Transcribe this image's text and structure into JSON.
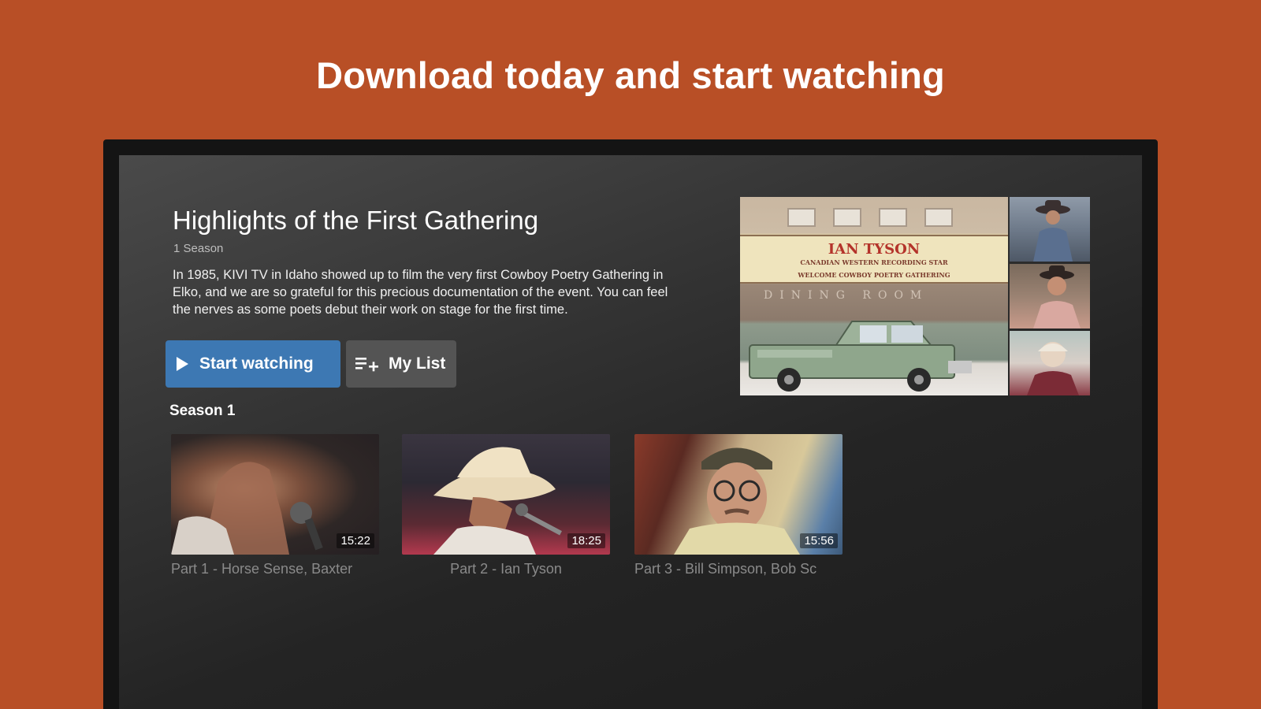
{
  "headline": "Download today and start watching",
  "show": {
    "title": "Highlights of the First Gathering",
    "season_count": "1 Season",
    "description": "In 1985, KIVI TV in Idaho showed up to film the very first Cowboy Poetry Gathering in Elko, and we are so grateful for this precious documentation of the event. You can feel the nerves as some poets debut their work on stage for the first time."
  },
  "buttons": {
    "start_watching": "Start watching",
    "my_list": "My List"
  },
  "hero_image": {
    "marquee_line1": "IAN TYSON",
    "marquee_line2": "CANADIAN WESTERN RECORDING STAR",
    "marquee_line3": "WELCOME COWBOY POETRY GATHERING",
    "building_sign": "DINING ROOM"
  },
  "season_label": "Season 1",
  "episodes": [
    {
      "title": "Part 1 - Horse Sense, Baxter",
      "duration": "15:22"
    },
    {
      "title": "Part 2 - Ian Tyson",
      "duration": "18:25"
    },
    {
      "title": "Part 3 - Bill Simpson, Bob Sc",
      "duration": "15:56"
    }
  ],
  "colors": {
    "background": "#b84f26",
    "accent_button": "#3d78b3",
    "secondary_button": "#545454"
  },
  "icons": {
    "play": "play-icon",
    "add_to_list": "playlist-add-icon"
  }
}
